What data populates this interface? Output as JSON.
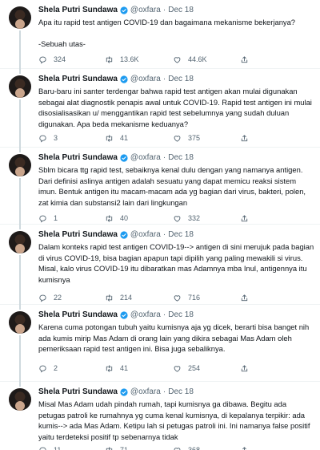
{
  "author": {
    "name": "Shela Putri Sundawa",
    "handle": "@oxfara"
  },
  "tweets": [
    {
      "date": "Dec 18",
      "text": "Apa itu rapid test antigen COVID-19 dan bagaimana mekanisme bekerjanya?\n\n-Sebuah utas-",
      "replies": "324",
      "retweets": "13.6K",
      "likes": "44.6K"
    },
    {
      "date": "Dec 18",
      "text": "Baru-baru ini santer terdengar bahwa rapid test antigen akan mulai digunakan sebagai alat diagnostik penapis awal untuk COVID-19. Rapid test antigen ini mulai disosialisasikan u/ menggantikan rapid test sebelumnya yang sudah duluan digunakan. Apa beda mekanisme keduanya?",
      "replies": "3",
      "retweets": "41",
      "likes": "375"
    },
    {
      "date": "Dec 18",
      "text": "Sblm bicara ttg rapid test, sebaiknya kenal dulu dengan yang namanya antigen. Dari definisi aslinya antigen adalah sesuatu yang dapat memicu reaksi sistem imun. Bentuk antigen itu macam-macam ada yg bagian dari virus, bakteri, polen, zat kimia dan substansi2 lain dari lingkungan",
      "replies": "1",
      "retweets": "40",
      "likes": "332"
    },
    {
      "date": "Dec 18",
      "text": "Dalam konteks rapid test antigen COVID-19--> antigen di sini merujuk pada bagian di virus COVID-19, bisa bagian apapun tapi dipilih yang paling mewakili si virus. Misal, kalo virus COVID-19 itu dibaratkan mas Adamnya mba Inul, antigennya itu kumisnya",
      "replies": "22",
      "retweets": "214",
      "likes": "716"
    },
    {
      "date": "Dec 18",
      "text": "Karena cuma potongan tubuh yaitu kumisnya aja yg dicek, berarti bisa banget nih ada kumis mirip Mas Adam di orang lain yang dikira sebagai Mas Adam oleh pemeriksaan rapid test antigen ini. Bisa juga sebaliknya.",
      "replies": "2",
      "retweets": "41",
      "likes": "254"
    },
    {
      "date": "Dec 18",
      "text": "Misal Mas Adam udah pindah rumah, tapi kumisnya ga dibawa. Begitu ada petugas patroli ke rumahnya yg cuma kenal kumisnya, di kepalanya terpikir: ada kumis--> ada Mas Adam. Ketipu lah si petugas patroli ini. Ini namanya false positif yaitu terdeteksi positif tp sebenarnya tidak",
      "replies": "11",
      "retweets": "71",
      "likes": "368"
    }
  ],
  "icons": {
    "reply": "reply-icon",
    "retweet": "retweet-icon",
    "like": "heart-icon",
    "share": "share-icon",
    "verified": "verified-badge-icon"
  },
  "colors": {
    "verified": "#1d9bf0",
    "muted": "#536471",
    "thread_line": "#cfd9de"
  }
}
